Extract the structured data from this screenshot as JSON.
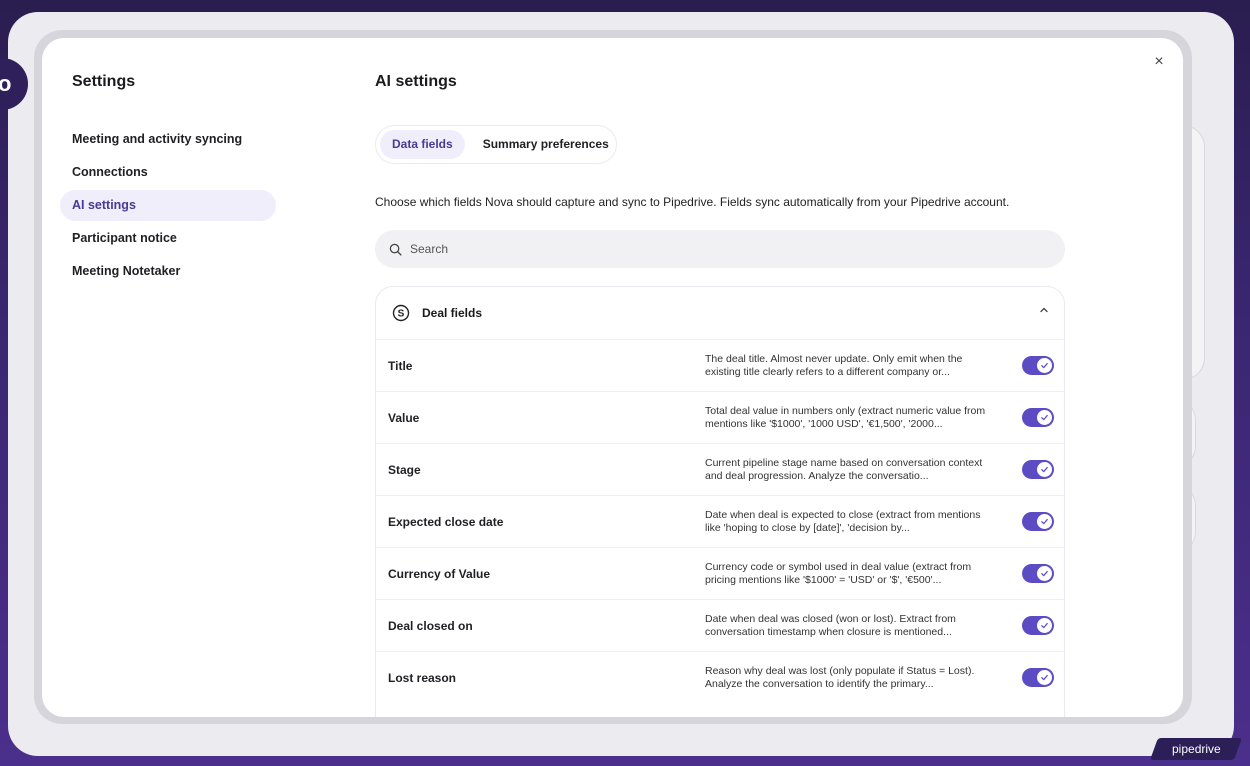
{
  "background": {
    "brand": "pipedrive",
    "logo_glyph": "o"
  },
  "colors": {
    "accent": "#5b4cc4",
    "active_bg": "#f1eefb",
    "active_text": "#4a3a94"
  },
  "sidebar": {
    "title": "Settings",
    "items": [
      {
        "label": "Meeting and activity syncing",
        "active": false
      },
      {
        "label": "Connections",
        "active": false
      },
      {
        "label": "AI settings",
        "active": true
      },
      {
        "label": "Participant notice",
        "active": false
      },
      {
        "label": "Meeting Notetaker",
        "active": false
      }
    ]
  },
  "main": {
    "title": "AI settings",
    "tabs": [
      {
        "label": "Data fields",
        "active": true
      },
      {
        "label": "Summary preferences",
        "active": false
      }
    ],
    "description": "Choose which fields Nova should capture and sync to Pipedrive. Fields sync automatically from your Pipedrive account.",
    "search": {
      "placeholder": "Search",
      "value": ""
    },
    "section": {
      "title": "Deal fields",
      "icon": "dollar-circle-icon",
      "expanded": true,
      "fields": [
        {
          "label": "Title",
          "description": "The deal title. Almost never update. Only emit when the existing title clearly refers to a different company or...",
          "enabled": true
        },
        {
          "label": "Value",
          "description": "Total deal value in numbers only (extract numeric value from mentions like '$1000', '1000 USD', '€1,500', '2000...",
          "enabled": true
        },
        {
          "label": "Stage",
          "description": "Current pipeline stage name based on conversation context and deal progression. Analyze the conversatio...",
          "enabled": true
        },
        {
          "label": "Expected close date",
          "description": "Date when deal is expected to close (extract from mentions like 'hoping to close by [date]', 'decision by...",
          "enabled": true
        },
        {
          "label": "Currency of Value",
          "description": "Currency code or symbol used in deal value (extract from pricing mentions like '$1000' = 'USD' or '$', '€500'...",
          "enabled": true
        },
        {
          "label": "Deal closed on",
          "description": "Date when deal was closed (won or lost). Extract from conversation timestamp when closure is mentioned...",
          "enabled": true
        },
        {
          "label": "Lost reason",
          "description": "Reason why deal was lost (only populate if Status = Lost). Analyze the conversation to identify the primary...",
          "enabled": true
        }
      ]
    }
  },
  "close_label": "×"
}
